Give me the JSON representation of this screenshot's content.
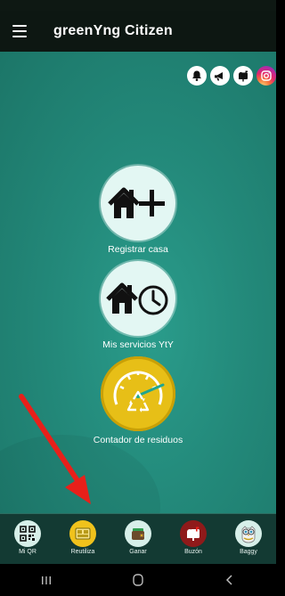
{
  "app": {
    "title": "greenYng Citizen"
  },
  "top_icons": [
    "bell-icon",
    "megaphone-icon",
    "mailbox-icon",
    "instagram-icon"
  ],
  "actions": [
    {
      "label": "Registrar casa",
      "icon": "house-plus-icon"
    },
    {
      "label": "Mis servicios YtY",
      "icon": "house-clock-icon"
    },
    {
      "label": "Contador de residuos",
      "icon": "recycle-gauge-icon"
    }
  ],
  "bottom_nav": [
    {
      "label": "Mi QR",
      "icon": "qr-code-icon"
    },
    {
      "label": "Reutiliza",
      "icon": "reuse-icon"
    },
    {
      "label": "Ganar",
      "icon": "wallet-icon"
    },
    {
      "label": "Buzón",
      "icon": "mailbox-icon"
    },
    {
      "label": "Baggy",
      "icon": "owl-icon"
    }
  ],
  "colors": {
    "app_bar": "#0d1712",
    "main_bg": "#23897a",
    "bottom_nav_bg": "#133a33",
    "highlight_arrow": "#e8201a",
    "gauge_yellow": "#e7bf17"
  }
}
